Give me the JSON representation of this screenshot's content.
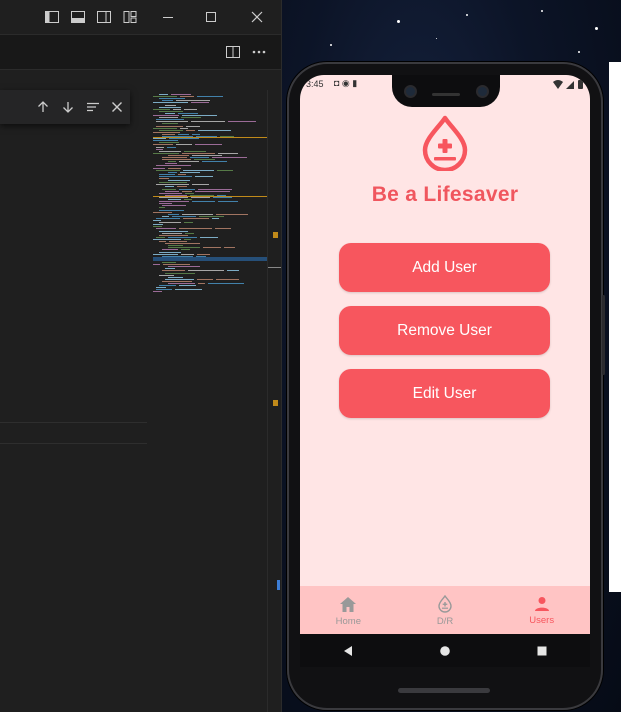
{
  "app": {
    "title": "Be a Lifesaver",
    "buttons": [
      "Add User",
      "Remove User",
      "Edit User"
    ],
    "nav": [
      {
        "label": "Home",
        "icon": "home-icon",
        "active": false
      },
      {
        "label": "D/R",
        "icon": "blood-drop-icon",
        "active": false
      },
      {
        "label": "Users",
        "icon": "person-icon",
        "active": true
      }
    ],
    "status_time": "3:45",
    "colors": {
      "accent": "#f7565e",
      "background": "#ffe5e5",
      "nav_background": "#ffc4c4",
      "nav_inactive": "#999999"
    }
  },
  "system_nav": [
    "back-icon",
    "home-circle-icon",
    "recents-icon"
  ],
  "editor": {
    "title_icons": [
      "layout-sidebar-left-icon",
      "layout-panel-icon",
      "layout-sidebar-right-icon",
      "layout-customize-icon"
    ],
    "window_controls": [
      "minimize-icon",
      "maximize-icon",
      "close-icon"
    ],
    "find_widget_icons": [
      "arrow-up-icon",
      "arrow-down-icon",
      "list-icon",
      "close-icon"
    ]
  }
}
